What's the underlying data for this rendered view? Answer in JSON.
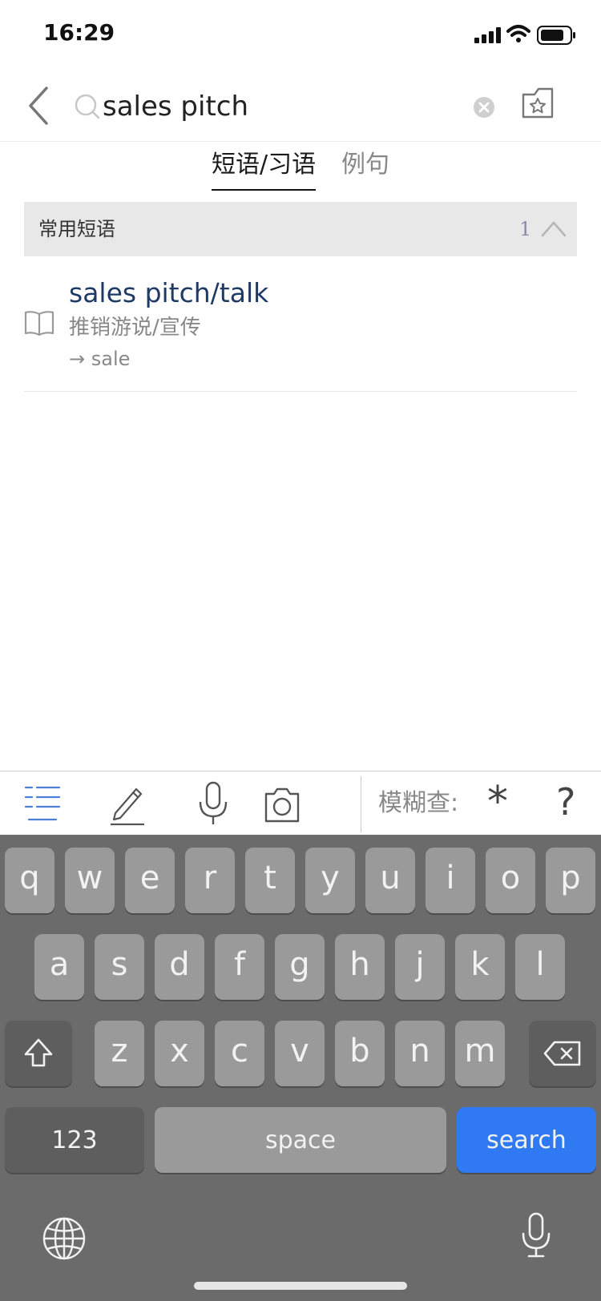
{
  "status_bar": {
    "time": "16:29"
  },
  "search": {
    "query": "sales pitch"
  },
  "tabs": [
    {
      "label": "短语/习语",
      "active": true
    },
    {
      "label": "例句",
      "active": false
    }
  ],
  "section": {
    "title": "常用短语",
    "count": "1"
  },
  "results": [
    {
      "phrase": "sales pitch/talk",
      "meaning": "推销游说/宣传",
      "link": "→ sale"
    }
  ],
  "toolbar": {
    "fuzzy_label": "模糊查:",
    "wildcard_star": "*",
    "wildcard_question": "?"
  },
  "keyboard": {
    "row1": [
      "q",
      "w",
      "e",
      "r",
      "t",
      "y",
      "u",
      "i",
      "o",
      "p"
    ],
    "row2": [
      "a",
      "s",
      "d",
      "f",
      "g",
      "h",
      "j",
      "k",
      "l"
    ],
    "row3": [
      "z",
      "x",
      "c",
      "v",
      "b",
      "n",
      "m"
    ],
    "numbers_label": "123",
    "space_label": "space",
    "search_label": "search"
  },
  "colors": {
    "accent": "#2f7af3",
    "result_title": "#1f3a66",
    "keyboard_bg": "#6b6b6b",
    "key_bg": "#9a9a9a"
  },
  "icons": [
    "back-chevron-icon",
    "search-icon",
    "clear-icon",
    "favorites-folder-icon",
    "collapse-chevron-icon",
    "book-icon",
    "list-icon",
    "pencil-icon",
    "microphone-icon",
    "camera-icon",
    "shift-icon",
    "backspace-icon",
    "globe-icon"
  ]
}
